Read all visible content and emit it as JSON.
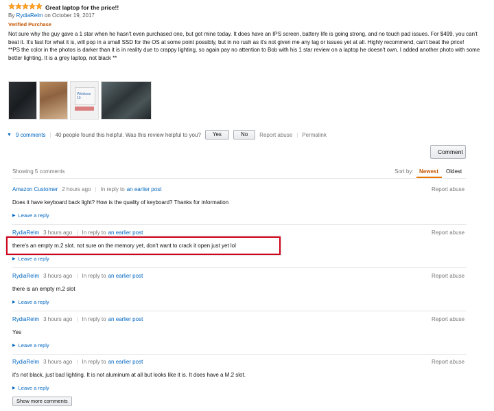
{
  "review": {
    "rating": 5,
    "title": "Great laptop for the price!!",
    "by_prefix": "By",
    "author": "RydiaRelm",
    "date": "on October 19, 2017",
    "verified": "Verified Purchase",
    "paragraphs": [
      "Not sure why the guy gave a 1 star when he hasn't even purchased one, but got mine today. It does have an IPS screen, battery life is going strong, and no touch pad issues. For $499, you can't beat it. It's fast for what it is, will pop in a small SSD for the OS at some point possibly, but in no rush as it's not given me any lag or issues yet at all. Highly recommend, can't beat the price!",
      "**PS the color in the photos is darker than it is in reality due to crappy lighting, so again pay no attention to Bob with his 1 star review on a laptop he doesn't own. I added another photo with some better lighting. It is a grey laptop, not black **"
    ],
    "photo_screen_text": "Windows 10",
    "comments_link": "9 comments",
    "helpful_text": "40 people found this helpful. Was this review helpful to you?",
    "yes_label": "Yes",
    "no_label": "No",
    "report_abuse": "Report abuse",
    "permalink": "Permalink"
  },
  "comments_section": {
    "comment_button": "Comment",
    "showing": "Showing 5 comments",
    "sort_by": "Sort by:",
    "sort_newest": "Newest",
    "sort_oldest": "Oldest",
    "show_more": "Show more comments",
    "comments": [
      {
        "author": "Amazon Customer",
        "time": "2 hours ago",
        "in_reply_to": "In reply to",
        "reply_link": "an earlier post",
        "text": "Does it have keyboard back light? How is the quality of keyboard? Thanks for information",
        "leave_reply": "Leave a reply",
        "report": "Report abuse"
      },
      {
        "author": "RydiaRelm",
        "time": "3 hours ago",
        "in_reply_to": "In reply to",
        "reply_link": "an earlier post",
        "text": "there's an empty m.2 slot. not sure on the memory yet, don't want to crack it open just yet lol",
        "leave_reply": "Leave a reply",
        "report": "Report abuse"
      },
      {
        "author": "RydiaRelm",
        "time": "3 hours ago",
        "in_reply_to": "In reply to",
        "reply_link": "an earlier post",
        "text": "there is an empty m.2 slot",
        "leave_reply": "Leave a reply",
        "report": "Report abuse"
      },
      {
        "author": "RydiaRelm",
        "time": "3 hours ago",
        "in_reply_to": "In reply to",
        "reply_link": "an earlier post",
        "text": "Yes",
        "leave_reply": "Leave a reply",
        "report": "Report abuse"
      },
      {
        "author": "RydiaRelm",
        "time": "3 hours ago",
        "in_reply_to": "In reply to",
        "reply_link": "an earlier post",
        "text": "it's not black, just bad lighting. It is not aluminum at all but looks like it is. It does have a M.2 slot.",
        "leave_reply": "Leave a reply",
        "report": "Report abuse"
      }
    ]
  },
  "colors": {
    "link": "#0066c0",
    "verified": "#c45500",
    "highlight": "#d0021b",
    "star": "#ffa41c"
  }
}
